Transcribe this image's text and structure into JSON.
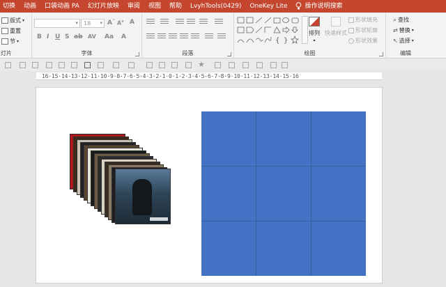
{
  "menu": {
    "tabs": [
      "切换",
      "动画",
      "口袋动画 PA",
      "幻灯片放映",
      "审阅",
      "视图",
      "帮助",
      "LvyhTools(0429)",
      "OneKey Lite"
    ],
    "tell_me": "操作说明搜索"
  },
  "ribbon": {
    "slides": {
      "layout": "版式",
      "reset": "重置",
      "section": "节",
      "label": "灯片"
    },
    "font": {
      "font_name": "",
      "font_size": "18",
      "label": "字体"
    },
    "paragraph": {
      "label": "段落"
    },
    "drawing": {
      "arrange": "排列",
      "quick_styles": "快速样式",
      "shape_fill": "形状填充",
      "shape_outline": "形状轮廓",
      "shape_effects": "形状效果",
      "label": "绘图"
    },
    "editing": {
      "find": "查找",
      "replace": "替换",
      "select": "选择",
      "label": "编辑"
    }
  },
  "ruler": {
    "text": "16·15·14·13·12·11·10·9·8·7·6·5·4·3·2·1·0·1·2·3·4·5·6·7·8·9·10·11·12·13·14·15·16"
  },
  "colors": {
    "accent": "#c4462e",
    "shape_fill": "#4472c4"
  }
}
